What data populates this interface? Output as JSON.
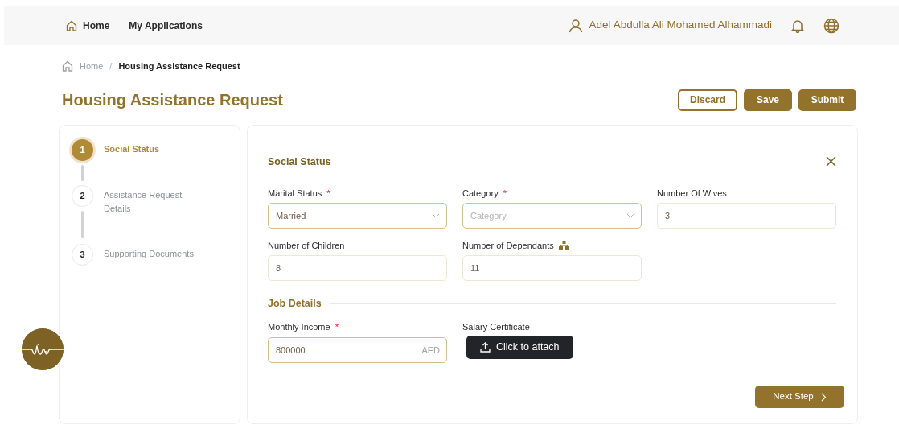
{
  "navbar": {
    "links": [
      {
        "label": "Home",
        "kind": "home"
      },
      {
        "label": "My Applications",
        "kind": "plain"
      }
    ],
    "user": "Adel Abdulla Ali Mohamed Alhammadi"
  },
  "breadcrumb": {
    "items": [
      "Home",
      "Housing Assistance Request"
    ],
    "separator": "/"
  },
  "page_title": "Housing Assistance Request",
  "actions": [
    {
      "label": "Discard",
      "kind": "outline"
    },
    {
      "label": "Save",
      "kind": "solid"
    },
    {
      "label": "Submit",
      "kind": "solid"
    }
  ],
  "steps": [
    {
      "number": "1",
      "label": "Social Status",
      "selected": true
    },
    {
      "number": "2",
      "label": "Assistance Request Details",
      "selected": false
    },
    {
      "number": "3",
      "label": "Supporting Documents",
      "selected": false
    }
  ],
  "form": {
    "title": "Social Status",
    "fields": [
      {
        "label": "Marital Status",
        "required_mark": "*",
        "kind": "select",
        "value": "Married"
      },
      {
        "label": "Category",
        "required_mark": "*",
        "kind": "select",
        "placeholder": "Category"
      },
      {
        "label": "Number Of Wives",
        "kind": "input",
        "value": "3"
      },
      {
        "label": "Number of Children",
        "kind": "input",
        "value": "8"
      },
      {
        "label": "Number of Dependants",
        "kind": "input",
        "value": "11",
        "hint_icon": true
      }
    ],
    "section": "Job Details",
    "job_fields": [
      {
        "label": "Monthly Income",
        "required_mark": "*",
        "kind": "input",
        "value": "800000",
        "suffix": "AED"
      },
      {
        "label": "Salary Certificate",
        "kind": "upload",
        "value": "Click to attach"
      }
    ],
    "next_button": "Next Step"
  }
}
